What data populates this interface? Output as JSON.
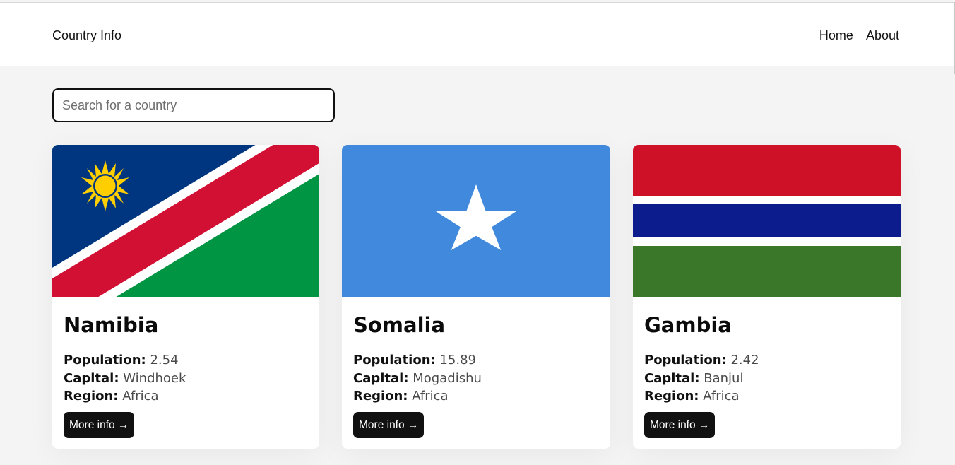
{
  "header": {
    "brand": "Country Info",
    "nav": [
      "Home",
      "About"
    ]
  },
  "search": {
    "placeholder": "Search for a country",
    "value": ""
  },
  "labels": {
    "population": "Population:",
    "capital": "Capital:",
    "region": "Region:",
    "more_info": "More info →"
  },
  "countries": [
    {
      "name": "Namibia",
      "population": "2.54",
      "capital": "Windhoek",
      "region": "Africa",
      "flag_colors": {
        "blue": "#003580",
        "red": "#D21034",
        "green": "#009543",
        "white": "#FFFFFF",
        "sun": "#FFCE00"
      }
    },
    {
      "name": "Somalia",
      "population": "15.89",
      "capital": "Mogadishu",
      "region": "Africa",
      "flag_colors": {
        "blue": "#4189DD",
        "star": "#FFFFFF"
      }
    },
    {
      "name": "Gambia",
      "population": "2.42",
      "capital": "Banjul",
      "region": "Africa",
      "flag_colors": {
        "red": "#CE1126",
        "white": "#FFFFFF",
        "blue": "#0C1C8C",
        "green": "#3A7728"
      }
    }
  ]
}
